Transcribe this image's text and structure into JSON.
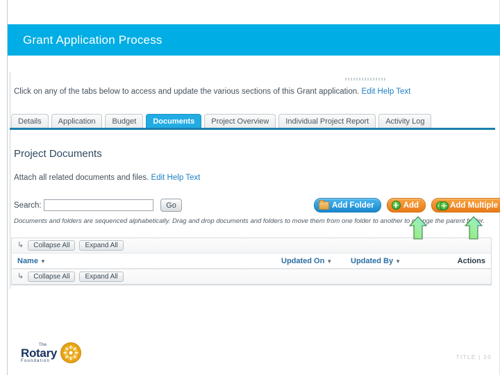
{
  "slide": {
    "title": "Grant Application Process",
    "banner_color": "#00ADE4",
    "footer": "TITLE | 10",
    "logo": {
      "the": "The",
      "name": "Rotary",
      "foundation": "Foundation"
    }
  },
  "screenshot": {
    "intro": {
      "text": "Click on any of the tabs below to access and update the various sections of this Grant application.",
      "link": "Edit Help Text"
    },
    "tabs": [
      {
        "label": "Details",
        "active": false
      },
      {
        "label": "Application",
        "active": false
      },
      {
        "label": "Budget",
        "active": false
      },
      {
        "label": "Documents",
        "active": true
      },
      {
        "label": "Project Overview",
        "active": false
      },
      {
        "label": "Individual Project Report",
        "active": false
      },
      {
        "label": "Activity Log",
        "active": false
      }
    ],
    "section": {
      "heading": "Project Documents",
      "subtext": "Attach all related documents and files.",
      "sub_link": "Edit Help Text"
    },
    "search": {
      "label": "Search:",
      "value": "",
      "placeholder": "",
      "go_label": "Go"
    },
    "actions": {
      "add_folder": "Add Folder",
      "add": "Add",
      "add_multiple": "Add Multiple",
      "add_folder_color": "#1888CD",
      "add_color": "#E87A18"
    },
    "note": "Documents and folders are sequenced alphabetically. Drag and drop documents and folders to move them from one folder to another to change the parent folder.",
    "table": {
      "toolbar": {
        "collapse_all": "Collapse All",
        "expand_all": "Expand All"
      },
      "columns": {
        "name": "Name",
        "updated_on": "Updated On",
        "updated_by": "Updated By",
        "actions": "Actions"
      },
      "sort_caret": "▼",
      "rows": []
    }
  }
}
